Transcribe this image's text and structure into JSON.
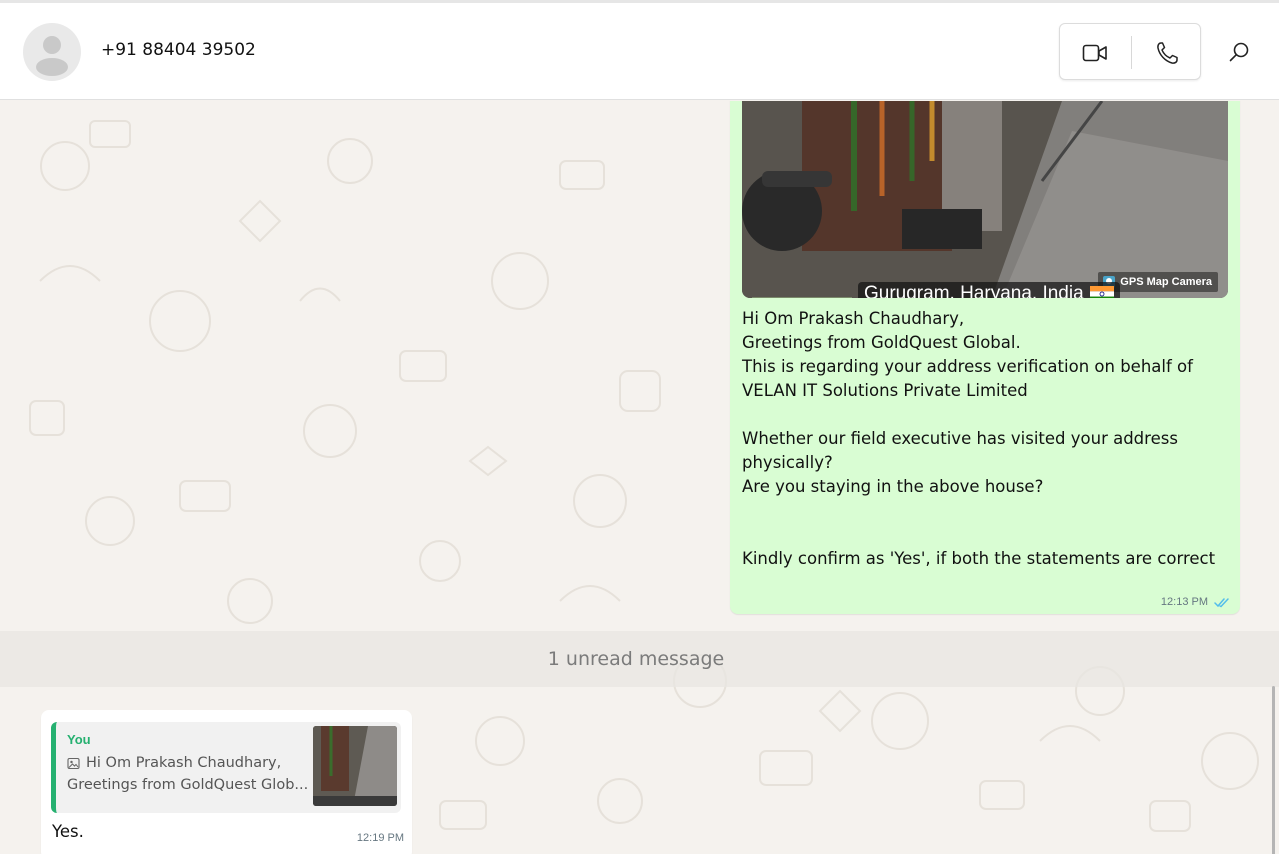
{
  "header": {
    "contact_name": "+91 88404 39502"
  },
  "outgoing_message": {
    "image": {
      "gps_tag": "GPS Map Camera",
      "location": "Gurugram, Haryana, India"
    },
    "lines": [
      "Hi Om Prakash Chaudhary,",
      "Greetings from GoldQuest Global.",
      "This is regarding your address verification on behalf of",
      "VELAN IT Solutions Private Limited",
      "",
      "Whether our field executive has visited your address",
      "physically?",
      "Are you staying in the above house?",
      "",
      "",
      "Kindly confirm as 'Yes', if both the statements are correct"
    ],
    "time": "12:13 PM",
    "status": "read"
  },
  "unread_divider": "1 unread message",
  "incoming_message": {
    "quote": {
      "author": "You",
      "line1": "Hi Om Prakash Chaudhary,",
      "line2": "Greetings from GoldQuest Glob..."
    },
    "text": "Yes.",
    "time": "12:19 PM"
  },
  "colors": {
    "outgoing_bubble": "#d9fdd3",
    "incoming_bubble": "#ffffff",
    "accent_green": "#25b070",
    "read_ticks": "#53bdeb",
    "chat_background": "#f5f2ee"
  },
  "icons": [
    "avatar-placeholder-icon",
    "video-call-icon",
    "voice-call-icon",
    "search-icon",
    "image-icon",
    "double-check-icon",
    "gps-map-camera-icon"
  ]
}
